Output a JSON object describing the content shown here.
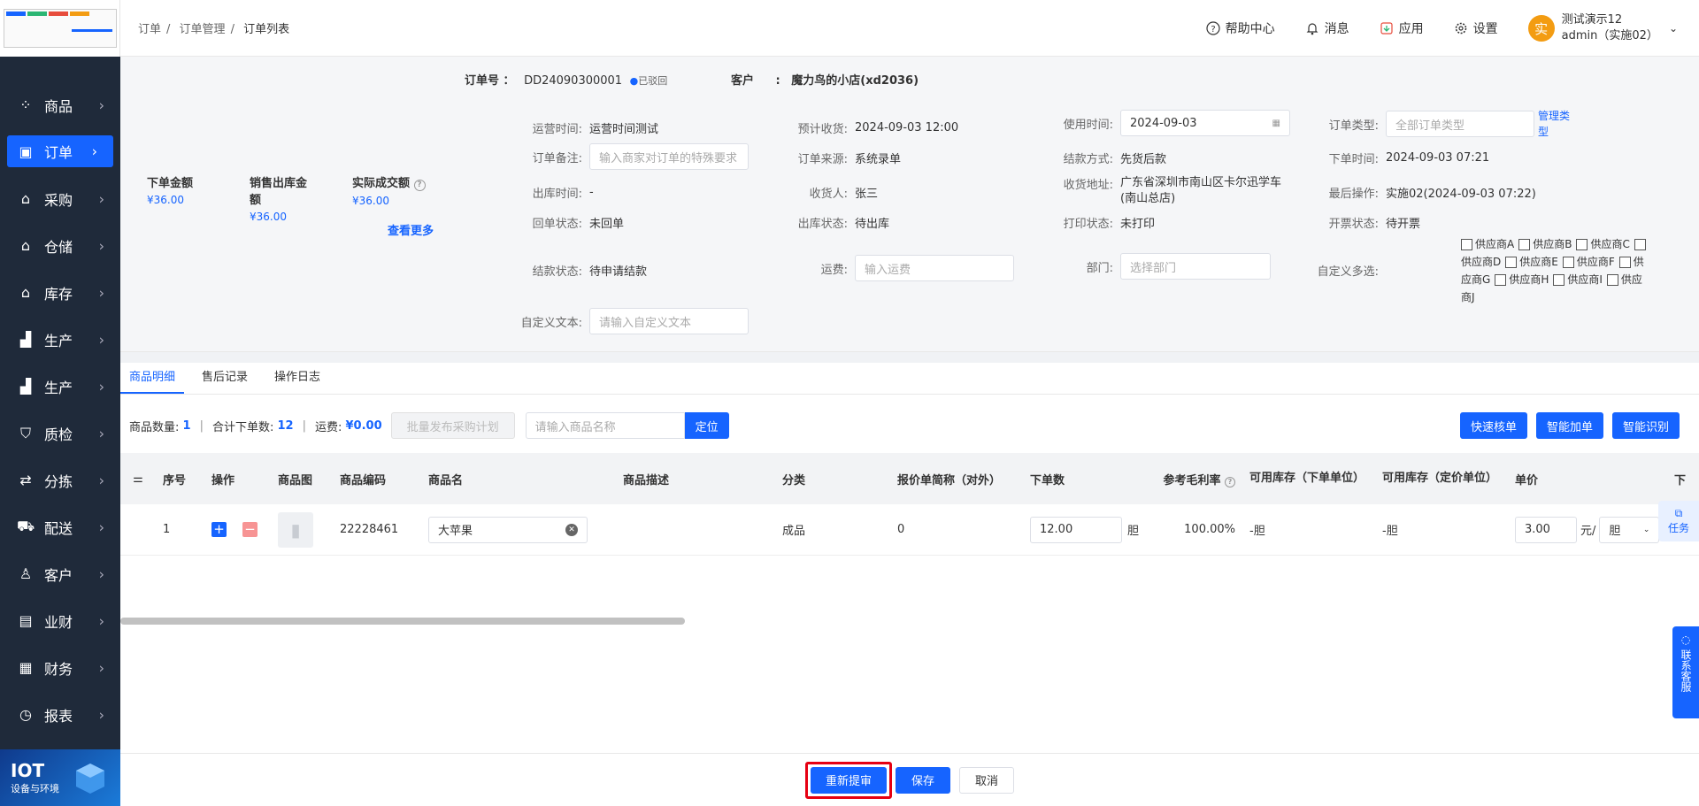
{
  "sidebar": {
    "items": [
      {
        "label": "商品",
        "icon": "grid-icon"
      },
      {
        "label": "订单",
        "icon": "order-icon"
      },
      {
        "label": "采购",
        "icon": "shop-icon"
      },
      {
        "label": "仓储",
        "icon": "warehouse-icon"
      },
      {
        "label": "库存",
        "icon": "inventory-icon"
      },
      {
        "label": "生产",
        "icon": "factory-icon"
      },
      {
        "label": "生产",
        "icon": "factory-icon"
      },
      {
        "label": "质检",
        "icon": "shield-icon"
      },
      {
        "label": "分拣",
        "icon": "sort-icon"
      },
      {
        "label": "配送",
        "icon": "truck-icon"
      },
      {
        "label": "客户",
        "icon": "user-icon"
      },
      {
        "label": "业财",
        "icon": "chart-icon"
      },
      {
        "label": "财务",
        "icon": "finance-icon"
      },
      {
        "label": "报表",
        "icon": "report-icon"
      }
    ],
    "iot_title": "IOT",
    "iot_sub": "设备与环境"
  },
  "breadcrumb": [
    "订单",
    "订单管理",
    "订单列表"
  ],
  "topbar": {
    "help": "帮助中心",
    "messages": "消息",
    "apps": "应用",
    "settings": "设置",
    "user_name": "测试演示12",
    "user_role": "admin（实施02）",
    "avatar_text": "实"
  },
  "order": {
    "no_label": "订单号 ：",
    "no": "DD24090300001",
    "status": "已驳回",
    "customer_label": "客户",
    "customer": "魔力鸟的小店(xd2036)"
  },
  "amounts": [
    {
      "label": "下单金额",
      "value": "¥36.00"
    },
    {
      "label": "销售出库金额",
      "value": "¥36.00"
    },
    {
      "label": "实际成交额",
      "value": "¥36.00"
    }
  ],
  "more_label": "查看更多",
  "fields": {
    "op_time_label": "运营时间:",
    "op_time": "运营时间测试",
    "est_recv_label": "预计收货:",
    "est_recv": "2024-09-03 12:00",
    "use_time_label": "使用时间:",
    "use_time": "2024-09-03",
    "order_type_label": "订单类型:",
    "order_type_ph": "全部订单类型",
    "manage_type": "管理类型",
    "remark_label": "订单备注:",
    "remark_ph": "输入商家对订单的特殊要求",
    "source_label": "订单来源:",
    "source": "系统录单",
    "settle_label": "结款方式:",
    "settle": "先货后款",
    "order_time_label": "下单时间:",
    "order_time": "2024-09-03 07:21",
    "out_time_label": "出库时间:",
    "out_time": "-",
    "receiver_label": "收货人:",
    "receiver": "张三",
    "addr_label": "收货地址:",
    "addr": "广东省深圳市南山区卡尔迅学车(南山总店)",
    "last_op_label": "最后操作:",
    "last_op": "实施02(2024-09-03 07:22)",
    "return_label": "回单状态:",
    "return": "未回单",
    "outstatus_label": "出库状态:",
    "outstatus": "待出库",
    "print_label": "打印状态:",
    "print": "未打印",
    "invoice_label": "开票状态:",
    "invoice": "待开票",
    "settle_status_label": "结款状态:",
    "settle_status": "待申请结款",
    "freight_label": "运费:",
    "freight_ph": "输入运费",
    "dept_label": "部门:",
    "dept_ph": "选择部门",
    "multi_label": "自定义多选:",
    "custom_text_label": "自定义文本:",
    "custom_text_ph": "请输入自定义文本"
  },
  "suppliers": [
    "供应商A",
    "供应商B",
    "供应商C",
    "供应商D",
    "供应商E",
    "供应商F",
    "供应商G",
    "供应商H",
    "供应商I",
    "供应商J"
  ],
  "tabs": [
    "商品明细",
    "售后记录",
    "操作日志"
  ],
  "toolbar": {
    "count_label": "商品数量:",
    "count": "1",
    "total_label": "合计下单数:",
    "total": "12",
    "freight_label": "运费:",
    "freight": "¥0.00",
    "batch_btn": "批量发布采购计划",
    "search_ph": "请输入商品名称",
    "locate_btn": "定位",
    "quick_btn": "快速核单",
    "smart_add_btn": "智能加单",
    "smart_rec_btn": "智能识别"
  },
  "table": {
    "headers": [
      "序号",
      "操作",
      "商品图",
      "商品编码",
      "商品名",
      "商品描述",
      "分类",
      "报价单简称（对外）",
      "下单数",
      "参考毛利率",
      "可用库存（下单单位）",
      "可用库存（定价单位）",
      "单价",
      "下"
    ],
    "row": {
      "idx": "1",
      "code": "22228461",
      "name": "大苹果",
      "category": "成品",
      "quote": "0",
      "qty": "12.00",
      "qty_unit": "胆",
      "margin": "100.00%",
      "stock1": "-胆",
      "stock2": "-胆",
      "price": "3.00",
      "price_unit": "元/",
      "unit_sel": "胆"
    }
  },
  "float": {
    "task": "任务",
    "service": "联系客服"
  },
  "bottom": {
    "resubmit": "重新提审",
    "save": "保存",
    "cancel": "取消"
  }
}
